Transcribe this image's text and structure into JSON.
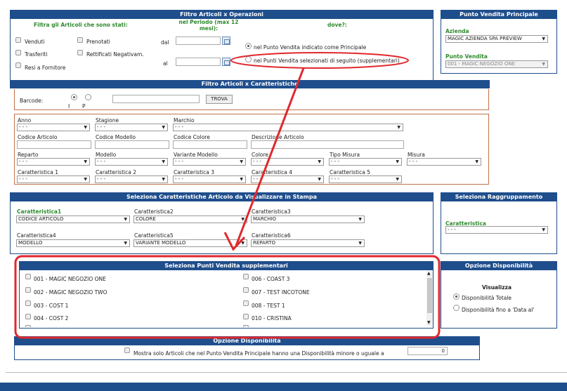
{
  "filtro_operazioni": {
    "title": "Filtro Articoli x Operazioni",
    "filtra_label": "Filtra gli Articoli che sono stati:",
    "periodo_label": "nel Periodo (max 12 mesi):",
    "dove_label": "dove?:",
    "checks": [
      "Venduti",
      "Prenotati",
      "Trasferiti",
      "Rettificati Negativam.",
      "Resi a Fornitore"
    ],
    "dal_label": "dal",
    "al_label": "al",
    "radio_principale": "nel Punto Vendita indicato come Principale",
    "radio_supplementari": "nei Punti Vendita selezionati di seguito (supplementari)"
  },
  "pv_principale": {
    "title": "Punto Vendita Principale",
    "azienda_label": "Azienda",
    "azienda_value": "MAGIC AZIENDA SPA PREVIEW",
    "pv_label": "Punto Vendita",
    "pv_value": "001 - MAGIC NEGOZIO ONE"
  },
  "filtro_caratteristiche": {
    "title": "Filtro Articoli x Caratteristiche",
    "barcode_label": "Barcode:",
    "radio_i": "I",
    "radio_p": "P",
    "trova_label": "TROVA",
    "anno_label": "Anno",
    "anno_value": "- - -",
    "stagione_label": "Stagione",
    "stagione_value": "- - -",
    "marchio_label": "Marchio",
    "marchio_value": "- - -",
    "codice_articolo_label": "Codice Articolo",
    "codice_modello_label": "Codice Modello",
    "codice_colore_label": "Codice Colore",
    "descrizione_label": "Descrizione Articolo",
    "reparto_label": "Reparto",
    "reparto_value": "- - -",
    "modello_label": "Modello",
    "modello_value": "- - -",
    "variante_label": "Variante Modello",
    "variante_value": "- - -",
    "colore_label": "Colore",
    "colore_value": "- - -",
    "tipo_misura_label": "Tipo Misura",
    "tipo_misura_value": "- - -",
    "misura_label": "Misura",
    "misura_value": "- - -",
    "car1_label": "Caratteristica 1",
    "car1_value": "- - -",
    "car2_label": "Caratteristica 2",
    "car2_value": "- - -",
    "car3_label": "Caratteristica 3",
    "car3_value": "- - -",
    "car4_label": "Caratteristica 4",
    "car4_value": "- - -",
    "car5_label": "Caratteristica 5",
    "car5_value": "- - -"
  },
  "stampa": {
    "title": "Seleziona Caratteristiche Articolo da Visualizzare in Stampa",
    "c1_label": "Caratteristica1",
    "c1_value": "CODICE ARTICOLO",
    "c2_label": "Caratteristica2",
    "c2_value": "COLORE",
    "c3_label": "Caratteristica3",
    "c3_value": "MARCHIO",
    "c4_label": "Caratteristica4",
    "c4_value": "MODELLO",
    "c5_label": "Caratteristica5",
    "c5_value": "VARIANTE MODELLO",
    "c6_label": "Caratteristica6",
    "c6_value": "REPARTO"
  },
  "raggruppamento": {
    "title": "Seleziona Raggruppamento",
    "car_label": "Caratteristica",
    "car_value": "- - -"
  },
  "pv_supplementari": {
    "title": "Seleziona Punti Vendita supplementari",
    "left": [
      "001 - MAGIC NEGOZIO ONE",
      "002 - MAGIC NEGOZIO TWO",
      "003 - COST 1",
      "004 - COST 2"
    ],
    "right": [
      "006 - COAST 3",
      "007 - TEST INCOTONE",
      "008 - TEST 1",
      "010 - CRISTINA"
    ]
  },
  "disponibilita": {
    "title": "Opzione Disponibilità",
    "visualizza_label": "Visualizza",
    "totale": "Disponibilità Totale",
    "fino_data": "Disponibilità fino a 'Data al'"
  },
  "opzione_disp": {
    "title": "Opzione Disponibilità",
    "check_label": "Mostra solo Articoli che nel Punto Vendita Principale hanno una Disponibilità minore o uguale a",
    "value": "0"
  },
  "colors": {
    "header": "#1f4e8c",
    "annotation": "#e0282e",
    "green": "#2e8b2e",
    "brown": "#c0724a"
  }
}
